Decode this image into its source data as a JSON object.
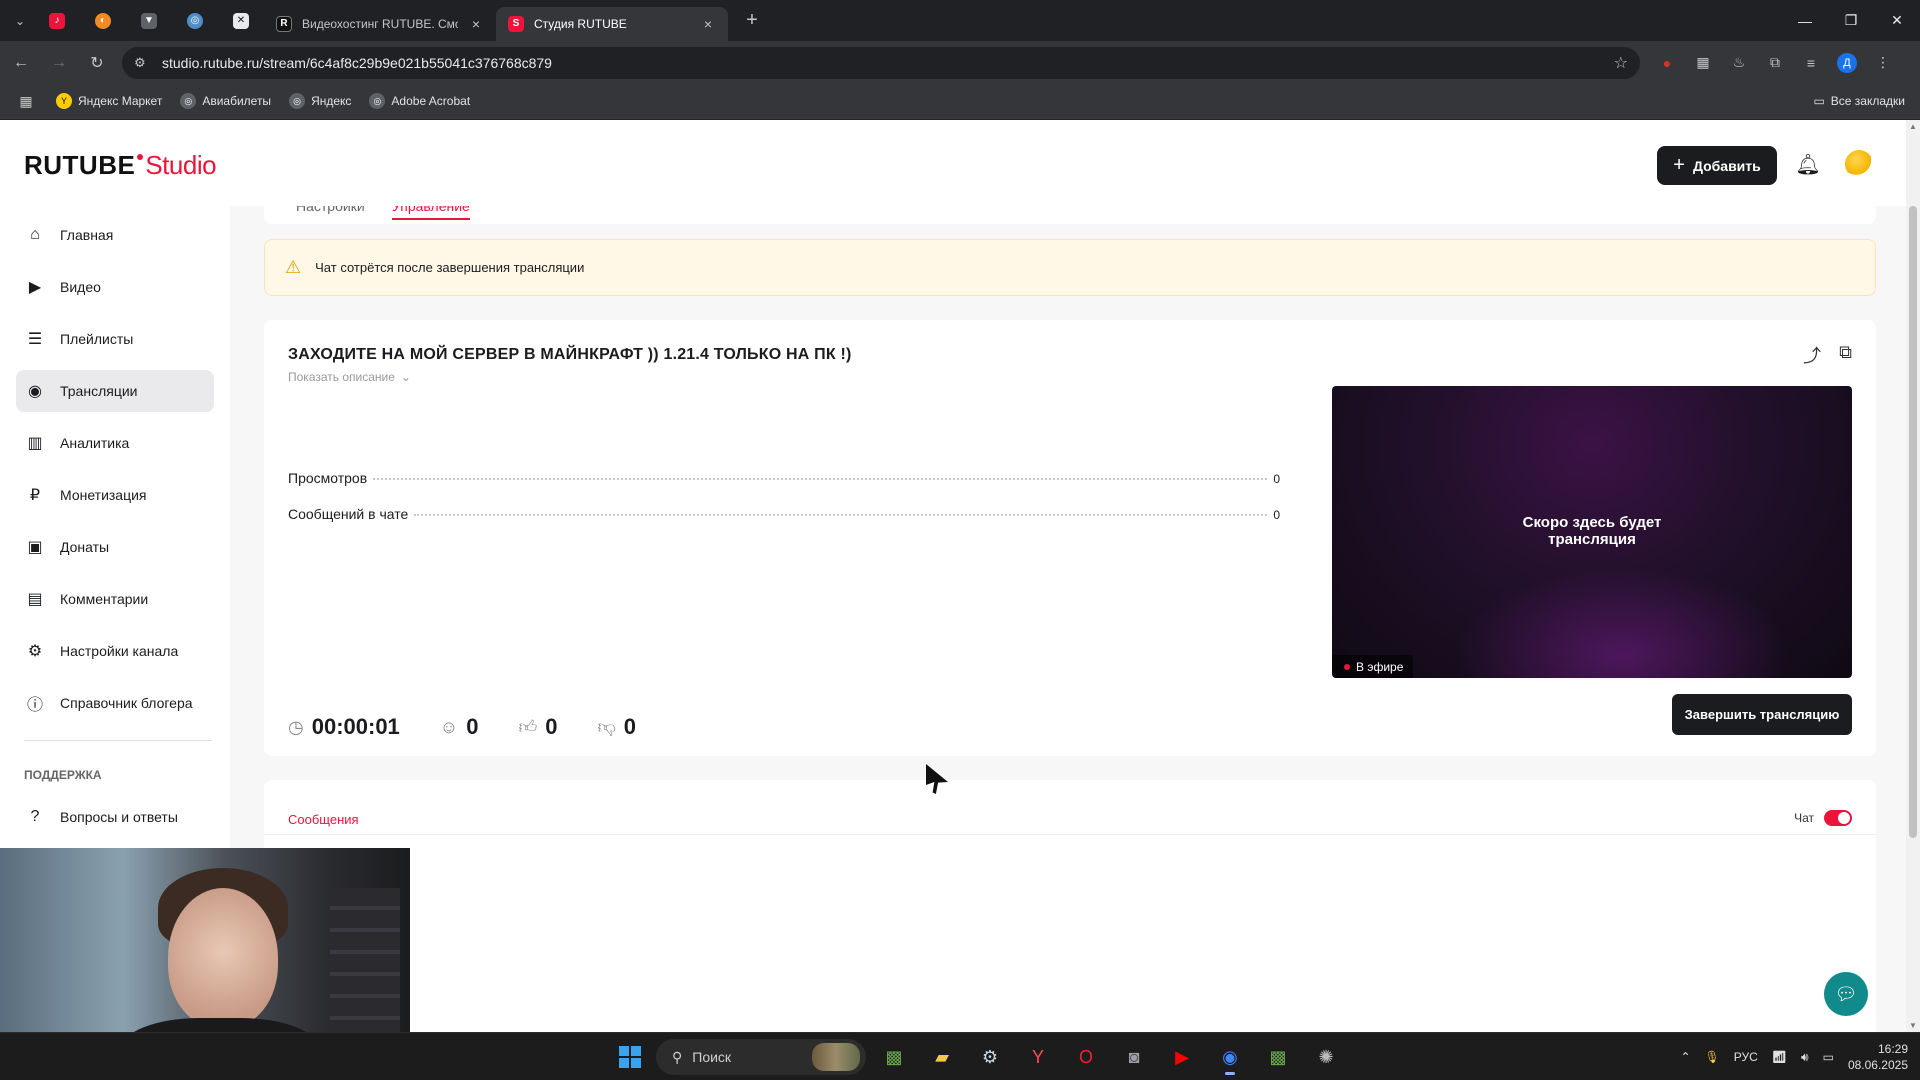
{
  "browser": {
    "pinned_tabs": [
      {
        "icon": "rutube-red-icon",
        "color": "#ed143b"
      },
      {
        "icon": "orange-app-icon",
        "color": "#f18a23"
      },
      {
        "icon": "sketch-icon",
        "color": "#9aa0a6"
      },
      {
        "icon": "globe-icon",
        "color": "#4f8fc7"
      },
      {
        "icon": "capcut-icon",
        "color": "#e8eaed"
      }
    ],
    "tabs": [
      {
        "title": "Видеохостинг RUTUBE. Смотрите",
        "favicon_letter": "R",
        "active": false
      },
      {
        "title": "Студия RUTUBE",
        "favicon_letter": "S",
        "active": true
      }
    ],
    "url": "studio.rutube.ru/stream/6c4af8c29b9e021b55041c376768c879",
    "profile_letter": "Д",
    "bookmarks": [
      {
        "label": "Яндекс Маркет"
      },
      {
        "label": "Авиабилеты"
      },
      {
        "label": "Яндекс"
      },
      {
        "label": "Adobe Acrobat"
      }
    ],
    "all_bookmarks_label": "Все закладки"
  },
  "header": {
    "logo_left": "RUTUBE",
    "logo_right": "Studio",
    "add_button_label": "Добавить",
    "brand_color": "#ed143b"
  },
  "sidebar": {
    "items": [
      {
        "label": "Главная",
        "icon": "home-icon",
        "glyph": "⌂"
      },
      {
        "label": "Видео",
        "icon": "video-icon",
        "glyph": "▶"
      },
      {
        "label": "Плейлисты",
        "icon": "playlist-icon",
        "glyph": "☰"
      },
      {
        "label": "Трансляции",
        "icon": "broadcast-icon",
        "glyph": "◉"
      },
      {
        "label": "Аналитика",
        "icon": "analytics-icon",
        "glyph": "▥"
      },
      {
        "label": "Монетизация",
        "icon": "ruble-icon",
        "glyph": "₽"
      },
      {
        "label": "Донаты",
        "icon": "wallet-icon",
        "glyph": "▣"
      },
      {
        "label": "Комментарии",
        "icon": "comments-icon",
        "glyph": "▤"
      },
      {
        "label": "Настройки канала",
        "icon": "gear-icon",
        "glyph": "⚙"
      },
      {
        "label": "Справочник блогера",
        "icon": "info-icon",
        "glyph": "ⓘ"
      }
    ],
    "active_index": 3,
    "support_section": "ПОДДЕРЖКА",
    "faq_label": "Вопросы и ответы"
  },
  "main": {
    "tabs": [
      {
        "label": "Настройки",
        "active": false
      },
      {
        "label": "Управление",
        "active": true
      }
    ],
    "warning_text": "Чат сотрётся после завершения трансляции",
    "stream": {
      "title": "ЗАХОДИТЕ НА МОЙ СЕРВЕР В МАЙНКРАФТ )) 1.21.4 ТОЛЬКО НА ПК !)",
      "show_description": "Показать описание",
      "stats": [
        {
          "label": "Просмотров",
          "value": "0"
        },
        {
          "label": "Сообщений в чате",
          "value": "0"
        }
      ],
      "player_message_line1": "Скоро здесь будет",
      "player_message_line2": "трансляция",
      "live_label": "В эфире",
      "timer": "00:00:01",
      "viewers": "0",
      "likes": "0",
      "dislikes": "0",
      "end_button_label": "Завершить трансляцию"
    },
    "messages": {
      "tab_label": "Сообщения",
      "chat_label": "Чат",
      "chat_enabled": true
    }
  },
  "taskbar": {
    "search_label": "Поиск",
    "language": "РУС",
    "time": "16:29",
    "date": "08.06.2025"
  }
}
